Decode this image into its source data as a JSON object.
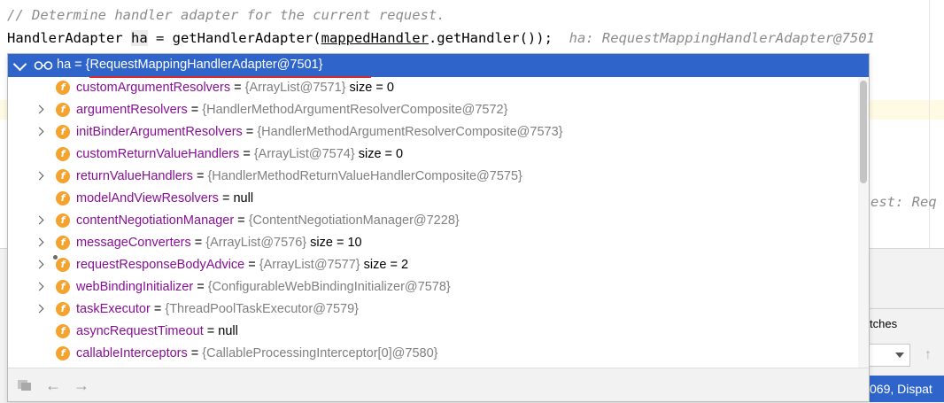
{
  "editor": {
    "comment_line": "// Determine handler adapter for the current request.",
    "code": {
      "type": "HandlerAdapter ",
      "var": "ha",
      "assign": " = getHandlerAdapter(",
      "arg": "mappedHandler",
      "rest": ".getHandler());",
      "hint": "ha: RequestMappingHandlerAdapter@7501"
    },
    "partial_hint": "est: Req"
  },
  "bottom": {
    "right_label": "tches",
    "status_text": "069, Dispat"
  },
  "popup": {
    "header": {
      "name": "ha",
      "equals": " = ",
      "value": "{RequestMappingHandlerAdapter@7501}"
    },
    "rows": [
      {
        "name": "customArgumentResolvers",
        "value": "{ArrayList@7571}",
        "extra": "size = 0",
        "expandable": false,
        "pinned": false
      },
      {
        "name": "argumentResolvers",
        "value": "{HandlerMethodArgumentResolverComposite@7572}",
        "extra": "",
        "expandable": true,
        "pinned": false
      },
      {
        "name": "initBinderArgumentResolvers",
        "value": "{HandlerMethodArgumentResolverComposite@7573}",
        "extra": "",
        "expandable": true,
        "pinned": false
      },
      {
        "name": "customReturnValueHandlers",
        "value": "{ArrayList@7574}",
        "extra": "size = 0",
        "expandable": false,
        "pinned": false
      },
      {
        "name": "returnValueHandlers",
        "value": "{HandlerMethodReturnValueHandlerComposite@7575}",
        "extra": "",
        "expandable": true,
        "pinned": false
      },
      {
        "name": "modelAndViewResolvers",
        "value": "null",
        "extra": "",
        "expandable": false,
        "pinned": false,
        "plain": true
      },
      {
        "name": "contentNegotiationManager",
        "value": "{ContentNegotiationManager@7228}",
        "extra": "",
        "expandable": true,
        "pinned": false
      },
      {
        "name": "messageConverters",
        "value": "{ArrayList@7576}",
        "extra": "size = 10",
        "expandable": true,
        "pinned": false
      },
      {
        "name": "requestResponseBodyAdvice",
        "value": "{ArrayList@7577}",
        "extra": "size = 2",
        "expandable": true,
        "pinned": true
      },
      {
        "name": "webBindingInitializer",
        "value": "{ConfigurableWebBindingInitializer@7578}",
        "extra": "",
        "expandable": true,
        "pinned": false
      },
      {
        "name": "taskExecutor",
        "value": "{ThreadPoolTaskExecutor@7579}",
        "extra": "",
        "expandable": true,
        "pinned": false
      },
      {
        "name": "asyncRequestTimeout",
        "value": "null",
        "extra": "",
        "expandable": false,
        "pinned": false,
        "plain": true
      },
      {
        "name": "callableInterceptors",
        "value": "{CallableProcessingInterceptor[0]@7580}",
        "extra": "",
        "expandable": false,
        "pinned": false
      }
    ],
    "field_icon_letter": "f",
    "eq": " = ",
    "colors": {
      "header_bg": "#2f65ca",
      "field_name": "#871094",
      "value": "#808080",
      "underline": "#d92b2b",
      "field_icon": "#f4a32f"
    },
    "footer_icons": [
      "copy-icon",
      "back-arrow-icon",
      "forward-arrow-icon"
    ]
  }
}
